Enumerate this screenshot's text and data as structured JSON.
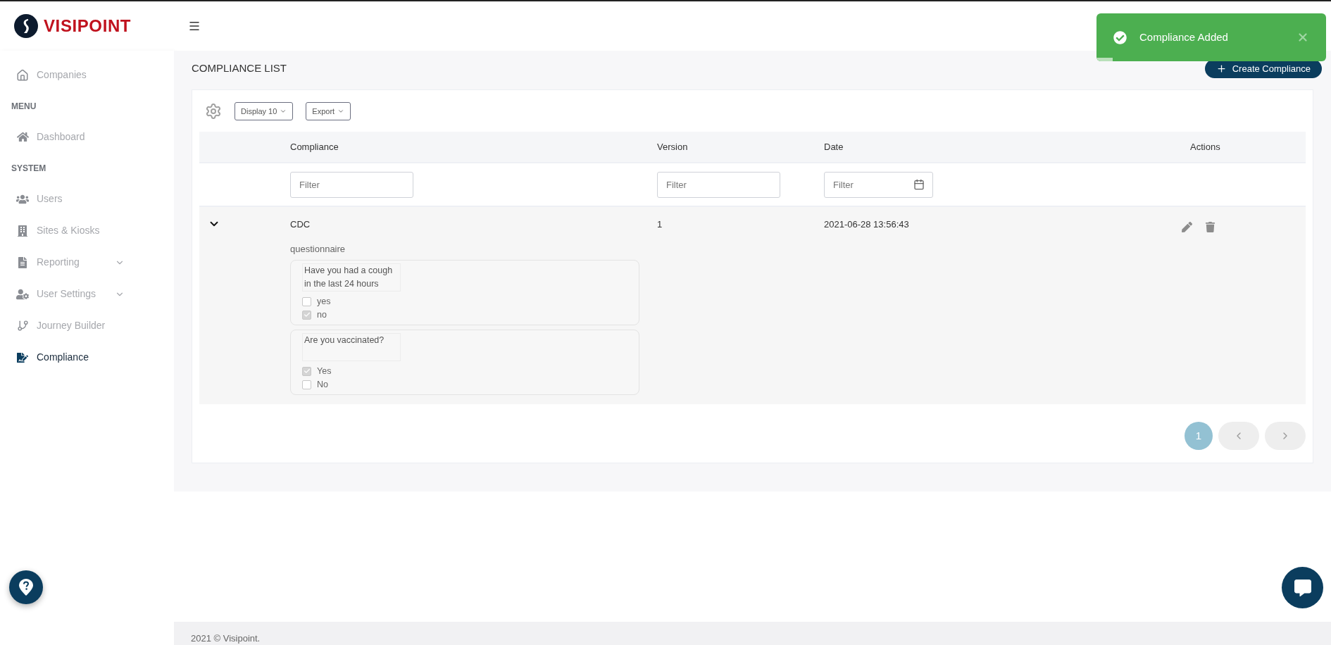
{
  "logo": {
    "text": "VISIPOINT"
  },
  "toast": {
    "message": "Compliance Added",
    "level": 0.07
  },
  "sidebar": {
    "items": [
      {
        "kind": "link",
        "label": "Companies",
        "selected": false,
        "has_submenu": false
      },
      {
        "kind": "heading",
        "label": "MENU"
      },
      {
        "kind": "link",
        "label": "Dashboard",
        "selected": false,
        "has_submenu": false
      },
      {
        "kind": "heading",
        "label": "SYSTEM"
      },
      {
        "kind": "link",
        "label": "Users",
        "selected": false,
        "has_submenu": false
      },
      {
        "kind": "link",
        "label": "Sites & Kiosks",
        "selected": false,
        "has_submenu": false
      },
      {
        "kind": "link",
        "label": "Reporting",
        "selected": false,
        "has_submenu": true
      },
      {
        "kind": "link",
        "label": "User Settings",
        "selected": false,
        "has_submenu": true
      },
      {
        "kind": "link",
        "label": "Journey Builder",
        "selected": false,
        "has_submenu": false
      },
      {
        "kind": "link",
        "label": "Compliance",
        "selected": true,
        "has_submenu": false
      }
    ]
  },
  "page": {
    "title": "COMPLIANCE LIST",
    "create_button": "Create Compliance"
  },
  "toolbar": {
    "display": "Display 10",
    "export": "Export"
  },
  "table": {
    "columns": [
      "Compliance",
      "Version",
      "Date",
      "Actions"
    ],
    "filters": [
      {
        "kind": "text",
        "placeholder": "Filter"
      },
      {
        "kind": "text",
        "placeholder": "Filter"
      },
      {
        "kind": "date",
        "placeholder": "Filter"
      }
    ],
    "rows": [
      {
        "expanded": true,
        "compliance": "CDC",
        "version": "1",
        "date": "2021-06-28 13:56:43",
        "details": {
          "label": "questionnaire",
          "questions": [
            {
              "text": "Have you had a cough in the last 24 hours",
              "options": [
                {
                  "label": "yes",
                  "checked": false
                },
                {
                  "label": "no",
                  "checked": true
                }
              ]
            },
            {
              "text": "Are you  vaccinated?",
              "options": [
                {
                  "label": "Yes",
                  "checked": true
                },
                {
                  "label": "No",
                  "checked": false
                }
              ]
            }
          ]
        }
      }
    ]
  },
  "pagination": {
    "pages": [
      {
        "label": "1",
        "selected": true
      }
    ]
  },
  "footer": {
    "text": "2021 © Visipoint."
  }
}
